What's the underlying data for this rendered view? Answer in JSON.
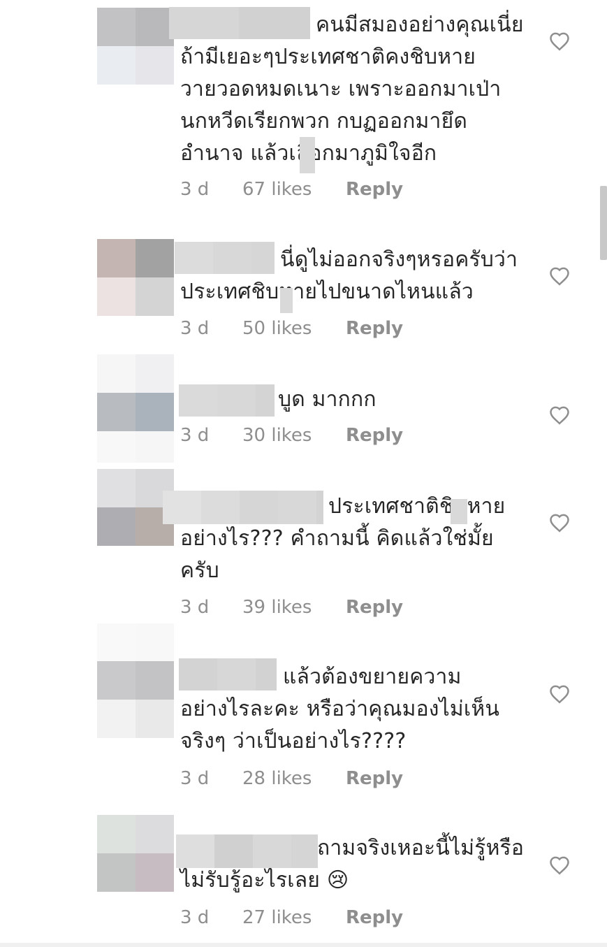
{
  "comments": [
    {
      "text": "คนมีสมองอย่างคุณเนี่ยถ้ามีเยอะๆประเทศชาติคงชิบหายวายวอดหมดเนาะ เพราะออกมาเป่านกหวีดเรียกพวก กบฏออกมายึดอำนาจ แล้วเลือกมาภูมิใจอีก",
      "time": "3 d",
      "likes": "67 likes",
      "reply": "Reply"
    },
    {
      "text": "นี่ดูไม่ออกจริงๆหรอครับว่าประเทศชิบหายไปขนาดไหนแล้ว",
      "time": "3 d",
      "likes": "50 likes",
      "reply": "Reply"
    },
    {
      "text": "บูด มากกก",
      "time": "3 d",
      "likes": "30 likes",
      "reply": "Reply"
    },
    {
      "text": "ประเทศชาติชิบหายอย่างไร??? คำถามนี้ คิดแล้วใช่มั้ยครับ",
      "time": "3 d",
      "likes": "39 likes",
      "reply": "Reply"
    },
    {
      "text": "แล้วต้องขยายความอย่างไรละคะ หรือว่าคุณมองไม่เห็นจริงๆ ว่าเป็นอย่างไร????",
      "time": "3 d",
      "likes": "28 likes",
      "reply": "Reply"
    },
    {
      "text": "ถามจริงเหอะนี้ไม่รู้หรือไม่รับรู้อะไรเลย 😢",
      "time": "3 d",
      "likes": "27 likes",
      "reply": "Reply"
    }
  ],
  "icons": {
    "like": "heart-outline-icon",
    "avatar": "pixelated-avatar"
  },
  "colors": {
    "text": "#262626",
    "meta": "#8e8e8e",
    "heart": "#8e8e8e"
  }
}
